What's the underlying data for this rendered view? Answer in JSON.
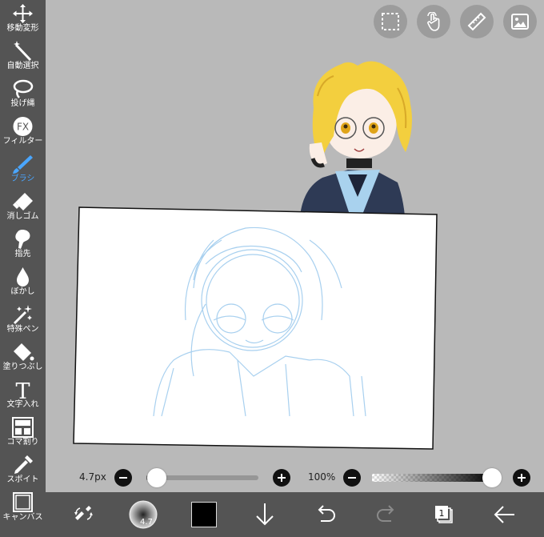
{
  "tools": [
    {
      "label": "移動変形",
      "icon": "move-icon"
    },
    {
      "label": "自動選択",
      "icon": "magic-wand-icon"
    },
    {
      "label": "投げ縄",
      "icon": "lasso-icon"
    },
    {
      "label": "フィルター",
      "icon": "fx-icon",
      "badge": "FX"
    },
    {
      "label": "ブラシ",
      "icon": "brush-icon",
      "active": true
    },
    {
      "label": "消しゴム",
      "icon": "eraser-icon"
    },
    {
      "label": "指先",
      "icon": "smudge-icon"
    },
    {
      "label": "ぼかし",
      "icon": "blur-drop-icon"
    },
    {
      "label": "特殊ペン",
      "icon": "special-pen-icon"
    },
    {
      "label": "塗りつぶし",
      "icon": "bucket-fill-icon"
    },
    {
      "label": "文字入れ",
      "icon": "text-icon",
      "glyph": "T"
    },
    {
      "label": "コマ割り",
      "icon": "frame-divider-icon"
    },
    {
      "label": "スポイト",
      "icon": "eyedropper-icon"
    },
    {
      "label": "キャンバス",
      "icon": "canvas-icon"
    }
  ],
  "brush": {
    "size_label": "4.7px",
    "size_fraction": 0.02,
    "badge": "4.7"
  },
  "opacity": {
    "label": "100%",
    "fraction": 1.0
  },
  "layer_count": "1",
  "colors": {
    "accent": "#4aa6ff",
    "current": "#000000",
    "sidebar": "#545454"
  }
}
